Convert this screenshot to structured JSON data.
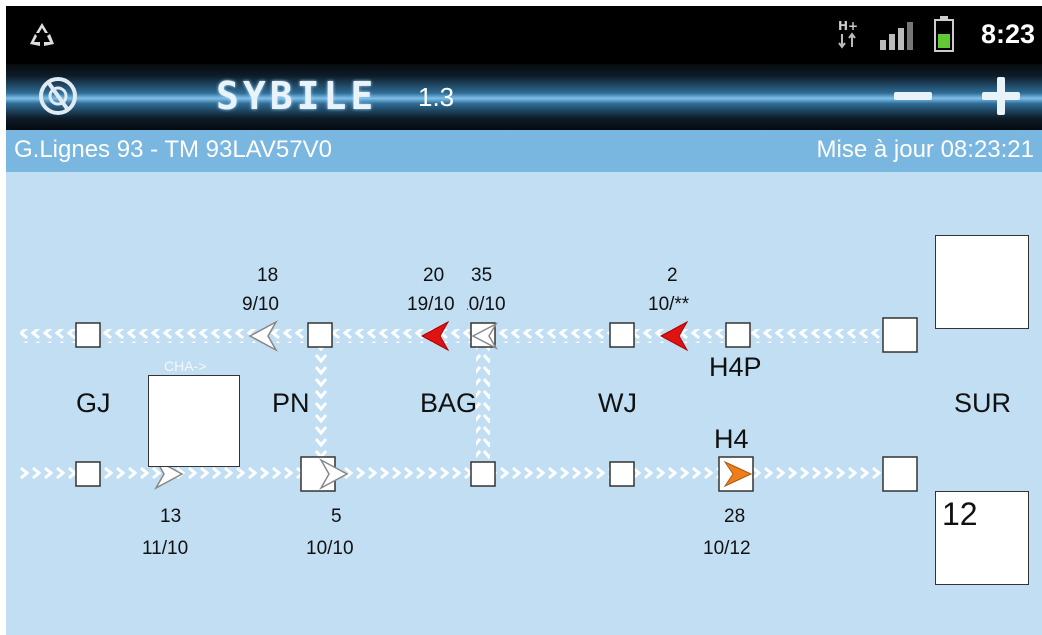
{
  "status": {
    "time": "8:23",
    "network_type": "H+",
    "icons": [
      "recycle-icon",
      "network-type-icon",
      "signal-icon",
      "battery-icon"
    ]
  },
  "app": {
    "brand": "SYBILE",
    "version": "1.3",
    "zoom_out": "−",
    "zoom_in": "+"
  },
  "info": {
    "line": "G.Lignes 93 - TM 93LAV57V0",
    "updated": "Mise à jour 08:23:21"
  },
  "stations": [
    "GJ",
    "PN",
    "BAG",
    "WJ",
    "SUR"
  ],
  "platforms": {
    "upper": "H4P",
    "lower": "H4"
  },
  "track_label": "CHA->",
  "trains_upper": [
    {
      "number": "18",
      "ratio": "9/10",
      "color": "white"
    },
    {
      "number": "20",
      "ratio": "19/10",
      "color": "red"
    },
    {
      "number": "35",
      "ratio": "10/10",
      "color": "white"
    },
    {
      "number": "2",
      "ratio": "10/**",
      "color": "red"
    }
  ],
  "trains_lower": [
    {
      "number": "13",
      "ratio": "11/10",
      "color": "white"
    },
    {
      "number": "5",
      "ratio": "10/10",
      "color": "white"
    },
    {
      "number": "28",
      "ratio": "10/12",
      "color": "orange"
    }
  ],
  "counter": "12",
  "colors": {
    "background": "#c2def3",
    "infobar": "#79b7e0",
    "red_train": "#e01313",
    "orange_train": "#ee7d1a",
    "track": "#ffffff"
  }
}
